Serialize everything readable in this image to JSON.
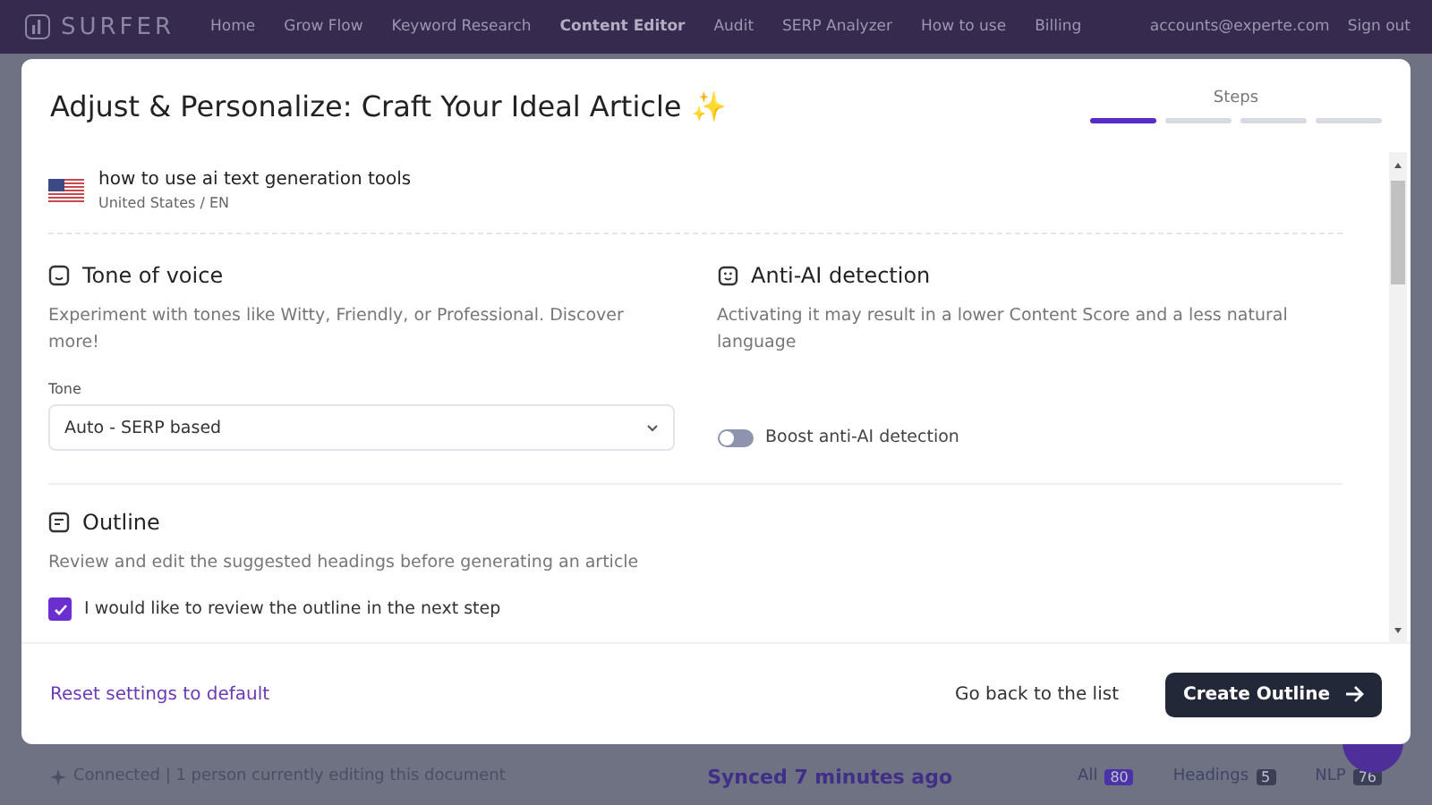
{
  "nav": {
    "logo": "SURFER",
    "links": [
      {
        "label": "Home",
        "selected": false
      },
      {
        "label": "Grow Flow",
        "selected": false
      },
      {
        "label": "Keyword Research",
        "selected": false
      },
      {
        "label": "Content Editor",
        "selected": true
      },
      {
        "label": "Audit",
        "selected": false
      },
      {
        "label": "SERP Analyzer",
        "selected": false
      },
      {
        "label": "How to use",
        "selected": false
      },
      {
        "label": "Billing",
        "selected": false
      }
    ],
    "account": "accounts@experte.com",
    "sign_out": "Sign out"
  },
  "modal": {
    "title": "Adjust & Personalize: Craft Your Ideal Article ✨",
    "steps_label": "Steps",
    "steps": [
      {
        "selected": true
      },
      {
        "selected": false
      },
      {
        "selected": false
      },
      {
        "selected": false
      }
    ],
    "keyword": {
      "text": "how to use ai text generation tools",
      "locale": "United States / EN"
    },
    "tone": {
      "heading": "Tone of voice",
      "description": "Experiment with tones like Witty, Friendly, or Professional. Discover more!",
      "field_label": "Tone",
      "value": "Auto - SERP based"
    },
    "anti_ai": {
      "heading": "Anti-AI detection",
      "description": "Activating it may result in a lower Content Score and a less natural language",
      "toggle_label": "Boost anti-AI detection",
      "on": false
    },
    "outline": {
      "heading": "Outline",
      "description": "Review and edit the suggested headings before generating an article",
      "checkbox_label": "I would like to review the outline in the next step",
      "checked": true
    },
    "reset": "Reset settings to default",
    "back": "Go back to the list",
    "create": "Create Outline"
  },
  "status_bar": {
    "connection": "Connected | 1 person currently editing this document",
    "synced": "Synced 7 minutes ago",
    "tabs": [
      {
        "label": "All",
        "count": "80",
        "selected": true
      },
      {
        "label": "Headings",
        "count": "5",
        "selected": false
      },
      {
        "label": "NLP",
        "count": "76",
        "selected": false
      }
    ]
  }
}
